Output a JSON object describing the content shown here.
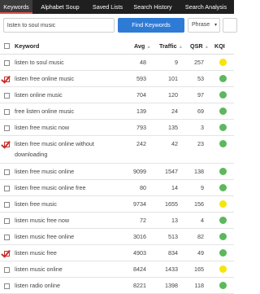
{
  "nav": {
    "tabs": [
      {
        "label": "Keywords",
        "active": true
      },
      {
        "label": "Alphabet Soup",
        "active": false
      },
      {
        "label": "Saved Lists",
        "active": false
      },
      {
        "label": "Search History",
        "active": false
      },
      {
        "label": "Search Analysis",
        "active": false
      }
    ]
  },
  "search": {
    "value": "listen to soul music",
    "find_label": "Find Keywords",
    "match_type": "Phrase"
  },
  "table": {
    "columns": {
      "keyword": "Keyword",
      "avg": "Avg",
      "traffic": "Traffic",
      "qsr": "QSR",
      "kqi": "KQI"
    },
    "rows": [
      {
        "keyword": "listen to soul music",
        "avg": "48",
        "traffic": "9",
        "qsr": "257",
        "kqi": "yellow",
        "checked": false
      },
      {
        "keyword": "listen free online music",
        "avg": "593",
        "traffic": "101",
        "qsr": "53",
        "kqi": "green",
        "checked": true
      },
      {
        "keyword": "listen online music",
        "avg": "704",
        "traffic": "120",
        "qsr": "97",
        "kqi": "green",
        "checked": false
      },
      {
        "keyword": "free listen online music",
        "avg": "139",
        "traffic": "24",
        "qsr": "69",
        "kqi": "green",
        "checked": false
      },
      {
        "keyword": "listen free music now",
        "avg": "793",
        "traffic": "135",
        "qsr": "3",
        "kqi": "green",
        "checked": false
      },
      {
        "keyword": "listen free music online without",
        "keyword2": "downloading",
        "avg": "242",
        "traffic": "42",
        "qsr": "23",
        "kqi": "green",
        "checked": true
      },
      {
        "keyword": "listen free music online",
        "avg": "9099",
        "traffic": "1547",
        "qsr": "138",
        "kqi": "green",
        "checked": false
      },
      {
        "keyword": "listen free music online free",
        "avg": "80",
        "traffic": "14",
        "qsr": "9",
        "kqi": "green",
        "checked": false
      },
      {
        "keyword": "listen free music",
        "avg": "9734",
        "traffic": "1655",
        "qsr": "156",
        "kqi": "yellow",
        "checked": false
      },
      {
        "keyword": "listen music free now",
        "avg": "72",
        "traffic": "13",
        "qsr": "4",
        "kqi": "green",
        "checked": false
      },
      {
        "keyword": "listen music free online",
        "avg": "3016",
        "traffic": "513",
        "qsr": "82",
        "kqi": "green",
        "checked": false
      },
      {
        "keyword": "listen music free",
        "avg": "4903",
        "traffic": "834",
        "qsr": "49",
        "kqi": "green",
        "checked": true
      },
      {
        "keyword": "listen music online",
        "avg": "8424",
        "traffic": "1433",
        "qsr": "165",
        "kqi": "yellow",
        "checked": false
      },
      {
        "keyword": "listen radio online",
        "avg": "8221",
        "traffic": "1398",
        "qsr": "118",
        "kqi": "green",
        "checked": false
      }
    ]
  },
  "colors": {
    "nav_bg": "#1f1f1f",
    "accent_blue": "#2e7bd6",
    "check_red": "#c9302c",
    "kqi_green": "#5cb85c",
    "kqi_yellow": "#f5e50a"
  }
}
